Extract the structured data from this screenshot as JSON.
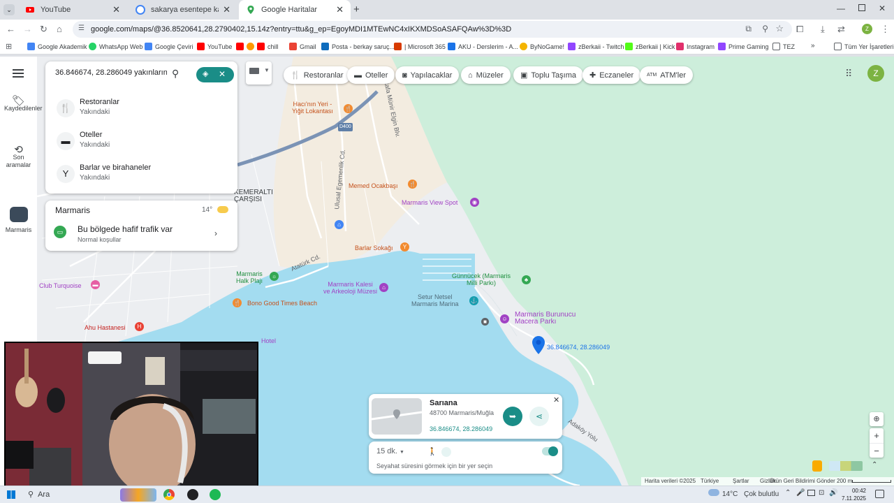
{
  "tabs": [
    {
      "title": "YouTube",
      "icon_color": "#ff0000",
      "active": false
    },
    {
      "title": "sakarya esentepe kampüsü - Go",
      "icon_color": "#4285f4",
      "active": false
    },
    {
      "title": "Google Haritalar",
      "icon_color": "#34a853",
      "active": true
    }
  ],
  "url": "google.com/maps/@36.8520641,28.2790402,15.14z?entry=ttu&g_ep=EgoyMDI1MTEwNC4xIKXMDSoASAFQAw%3D%3D",
  "profile_initial": "Z",
  "bookmarks": [
    {
      "label": "Google Akademik",
      "color": "#4285f4"
    },
    {
      "label": "WhatsApp Web",
      "color": "#25d366"
    },
    {
      "label": "Google Çeviri",
      "color": "#4285f4"
    },
    {
      "label": "YouTube",
      "color": "#ff0000"
    },
    {
      "label": "chill",
      "color": "#ff0000"
    },
    {
      "label": "Gmail",
      "color": "#ea4335"
    },
    {
      "label": "Posta - berkay saruç...",
      "color": "#0f6cbd"
    },
    {
      "label": "| Microsoft 365",
      "color": "#d83b01"
    },
    {
      "label": "AKU - Derslerim - A...",
      "color": "#1a73e8"
    },
    {
      "label": "ByNoGame!",
      "color": "#f4b400"
    },
    {
      "label": "zBerkaii - Twitch",
      "color": "#9146ff"
    },
    {
      "label": "zBerkaii | Kick",
      "color": "#53fc18"
    },
    {
      "label": "Instagram",
      "color": "#e1306c"
    },
    {
      "label": "Prime Gaming",
      "color": "#9146ff"
    },
    {
      "label": "TEZ",
      "color": "#5f6368"
    }
  ],
  "all_bookmarks": "Tüm Yer İşaretleri",
  "rail": {
    "saved": "Kaydedilenler",
    "recent": "Son aramalar",
    "marmaris": "Marmaris"
  },
  "search": {
    "value": "36.846674, 28.286049 yakınların"
  },
  "suggestions": [
    {
      "title": "Restoranlar",
      "sub": "Yakındaki",
      "icon": "fork-knife-icon"
    },
    {
      "title": "Oteller",
      "sub": "Yakındaki",
      "icon": "bed-icon"
    },
    {
      "title": "Barlar ve birahaneler",
      "sub": "Yakındaki",
      "icon": "cocktail-icon"
    }
  ],
  "weather_card": {
    "city": "Marmaris",
    "temp": "14°",
    "traffic_title": "Bu bölgede hafif trafik var",
    "traffic_sub": "Normal koşullar"
  },
  "chips": [
    "Restoranlar",
    "Oteller",
    "Yapılacaklar",
    "Müzeler",
    "Toplu Taşıma",
    "Eczaneler",
    "ATM'ler"
  ],
  "map_labels": {
    "haci": "Hacı'nın Yeri -\nYiğit Lokantası",
    "mustafa": "Mustafa Münir Elgin Blv.",
    "d400": "D400",
    "kemeralti": "KEMERALTI\nÇARŞISI",
    "ulusal": "Ulusal Egemenlik Cd.",
    "memed": "Memed Ocakbaşı",
    "viewspot": "Marmaris View Spot",
    "barlar": "Barlar Sokağı",
    "ataturk": "Atatürk Cd.",
    "halk": "Marmaris\nHalk Plajı",
    "kale": "Marmaris Kalesi\nve Arkeoloji Müzesi",
    "club": "Club Turquoise",
    "bono": "Bono Good Times Beach",
    "netsel": "Setur Netsel\nMarmaris Marina",
    "gunnucek": "Günnücek (Marmaris\nMilli Parkı)",
    "burunucu": "Marmaris Burunucu\nMacera Parkı",
    "coord": "36.846674, 28.286049",
    "ahu": "Ahu Hastanesi",
    "hotel": "Hotel",
    "adakoy": "Adaköy Yolu"
  },
  "place_card": {
    "name": "Sarıana",
    "address": "48700 Marmaris/Muğla",
    "coords": "36.846674, 28.286049"
  },
  "travel": {
    "duration": "15 dk.",
    "hint": "Seyahat süresini görmek için bir yer seçin"
  },
  "footer": [
    "Harita verileri ©2025",
    "Türkiye",
    "Şartlar",
    "Gizlilik",
    "Ürün Geri Bildirimi Gönder",
    "200 m"
  ],
  "taskbar": {
    "search": "Ara",
    "weather": "14°C",
    "weather_text": "Çok bulutlu",
    "time": "00:42",
    "date": "7.11.2025"
  },
  "colors": {
    "water": "#a3dcf0",
    "park": "#c8ecd8",
    "land": "#e8ebee",
    "accent": "#1a8d87",
    "pin": "#1a73e8"
  }
}
